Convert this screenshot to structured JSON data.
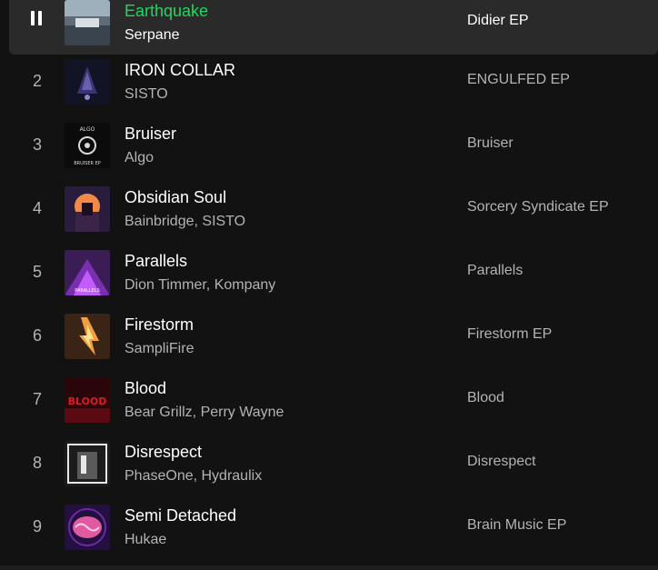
{
  "tracks": [
    {
      "index": "",
      "title": "Earthquake",
      "artist": "Serpane",
      "album": "Didier EP",
      "playing": true
    },
    {
      "index": "2",
      "title": "IRON COLLAR",
      "artist": "SISTO",
      "album": "ENGULFED EP"
    },
    {
      "index": "3",
      "title": "Bruiser",
      "artist": "Algo",
      "album": "Bruiser"
    },
    {
      "index": "4",
      "title": "Obsidian Soul",
      "artist": "Bainbridge, SISTO",
      "album": "Sorcery Syndicate EP"
    },
    {
      "index": "5",
      "title": "Parallels",
      "artist": "Dion Timmer, Kompany",
      "album": "Parallels"
    },
    {
      "index": "6",
      "title": "Firestorm",
      "artist": "SampliFire",
      "album": "Firestorm EP"
    },
    {
      "index": "7",
      "title": "Blood",
      "artist": "Bear Grillz, Perry Wayne",
      "album": "Blood"
    },
    {
      "index": "8",
      "title": "Disrespect",
      "artist": "PhaseOne, Hydraulix",
      "album": "Disrespect"
    },
    {
      "index": "9",
      "title": "Semi Detached",
      "artist": "Hukae",
      "album": "Brain Music EP"
    }
  ],
  "cover_art": [
    {
      "text": "",
      "colors": [
        "#3e4a58",
        "#c7d0d8"
      ]
    },
    {
      "text": "",
      "colors": [
        "#1c1838",
        "#6b5fb0"
      ]
    },
    {
      "text": "ALGO · BRUISER EP",
      "colors": [
        "#0b0b0b",
        "#d8d8d8"
      ]
    },
    {
      "text": "",
      "colors": [
        "#3a2448",
        "#f08a4b"
      ]
    },
    {
      "text": "PARALLELS",
      "colors": [
        "#3b1d55",
        "#c35cff"
      ]
    },
    {
      "text": "",
      "colors": [
        "#3a2416",
        "#f0a040"
      ]
    },
    {
      "text": "BLOOD",
      "colors": [
        "#2a0608",
        "#e01828"
      ]
    },
    {
      "text": "",
      "colors": [
        "#2a2a2a",
        "#e8e8e8"
      ]
    },
    {
      "text": "",
      "colors": [
        "#3a1458",
        "#e05aa0"
      ]
    }
  ],
  "theme": {
    "background": "#121212",
    "active_row": "#2a2a2a",
    "accent_green": "#1ed760",
    "text_primary": "#ffffff",
    "text_secondary": "#b3b3b3"
  },
  "icons": {
    "now_playing": "pause-icon"
  }
}
